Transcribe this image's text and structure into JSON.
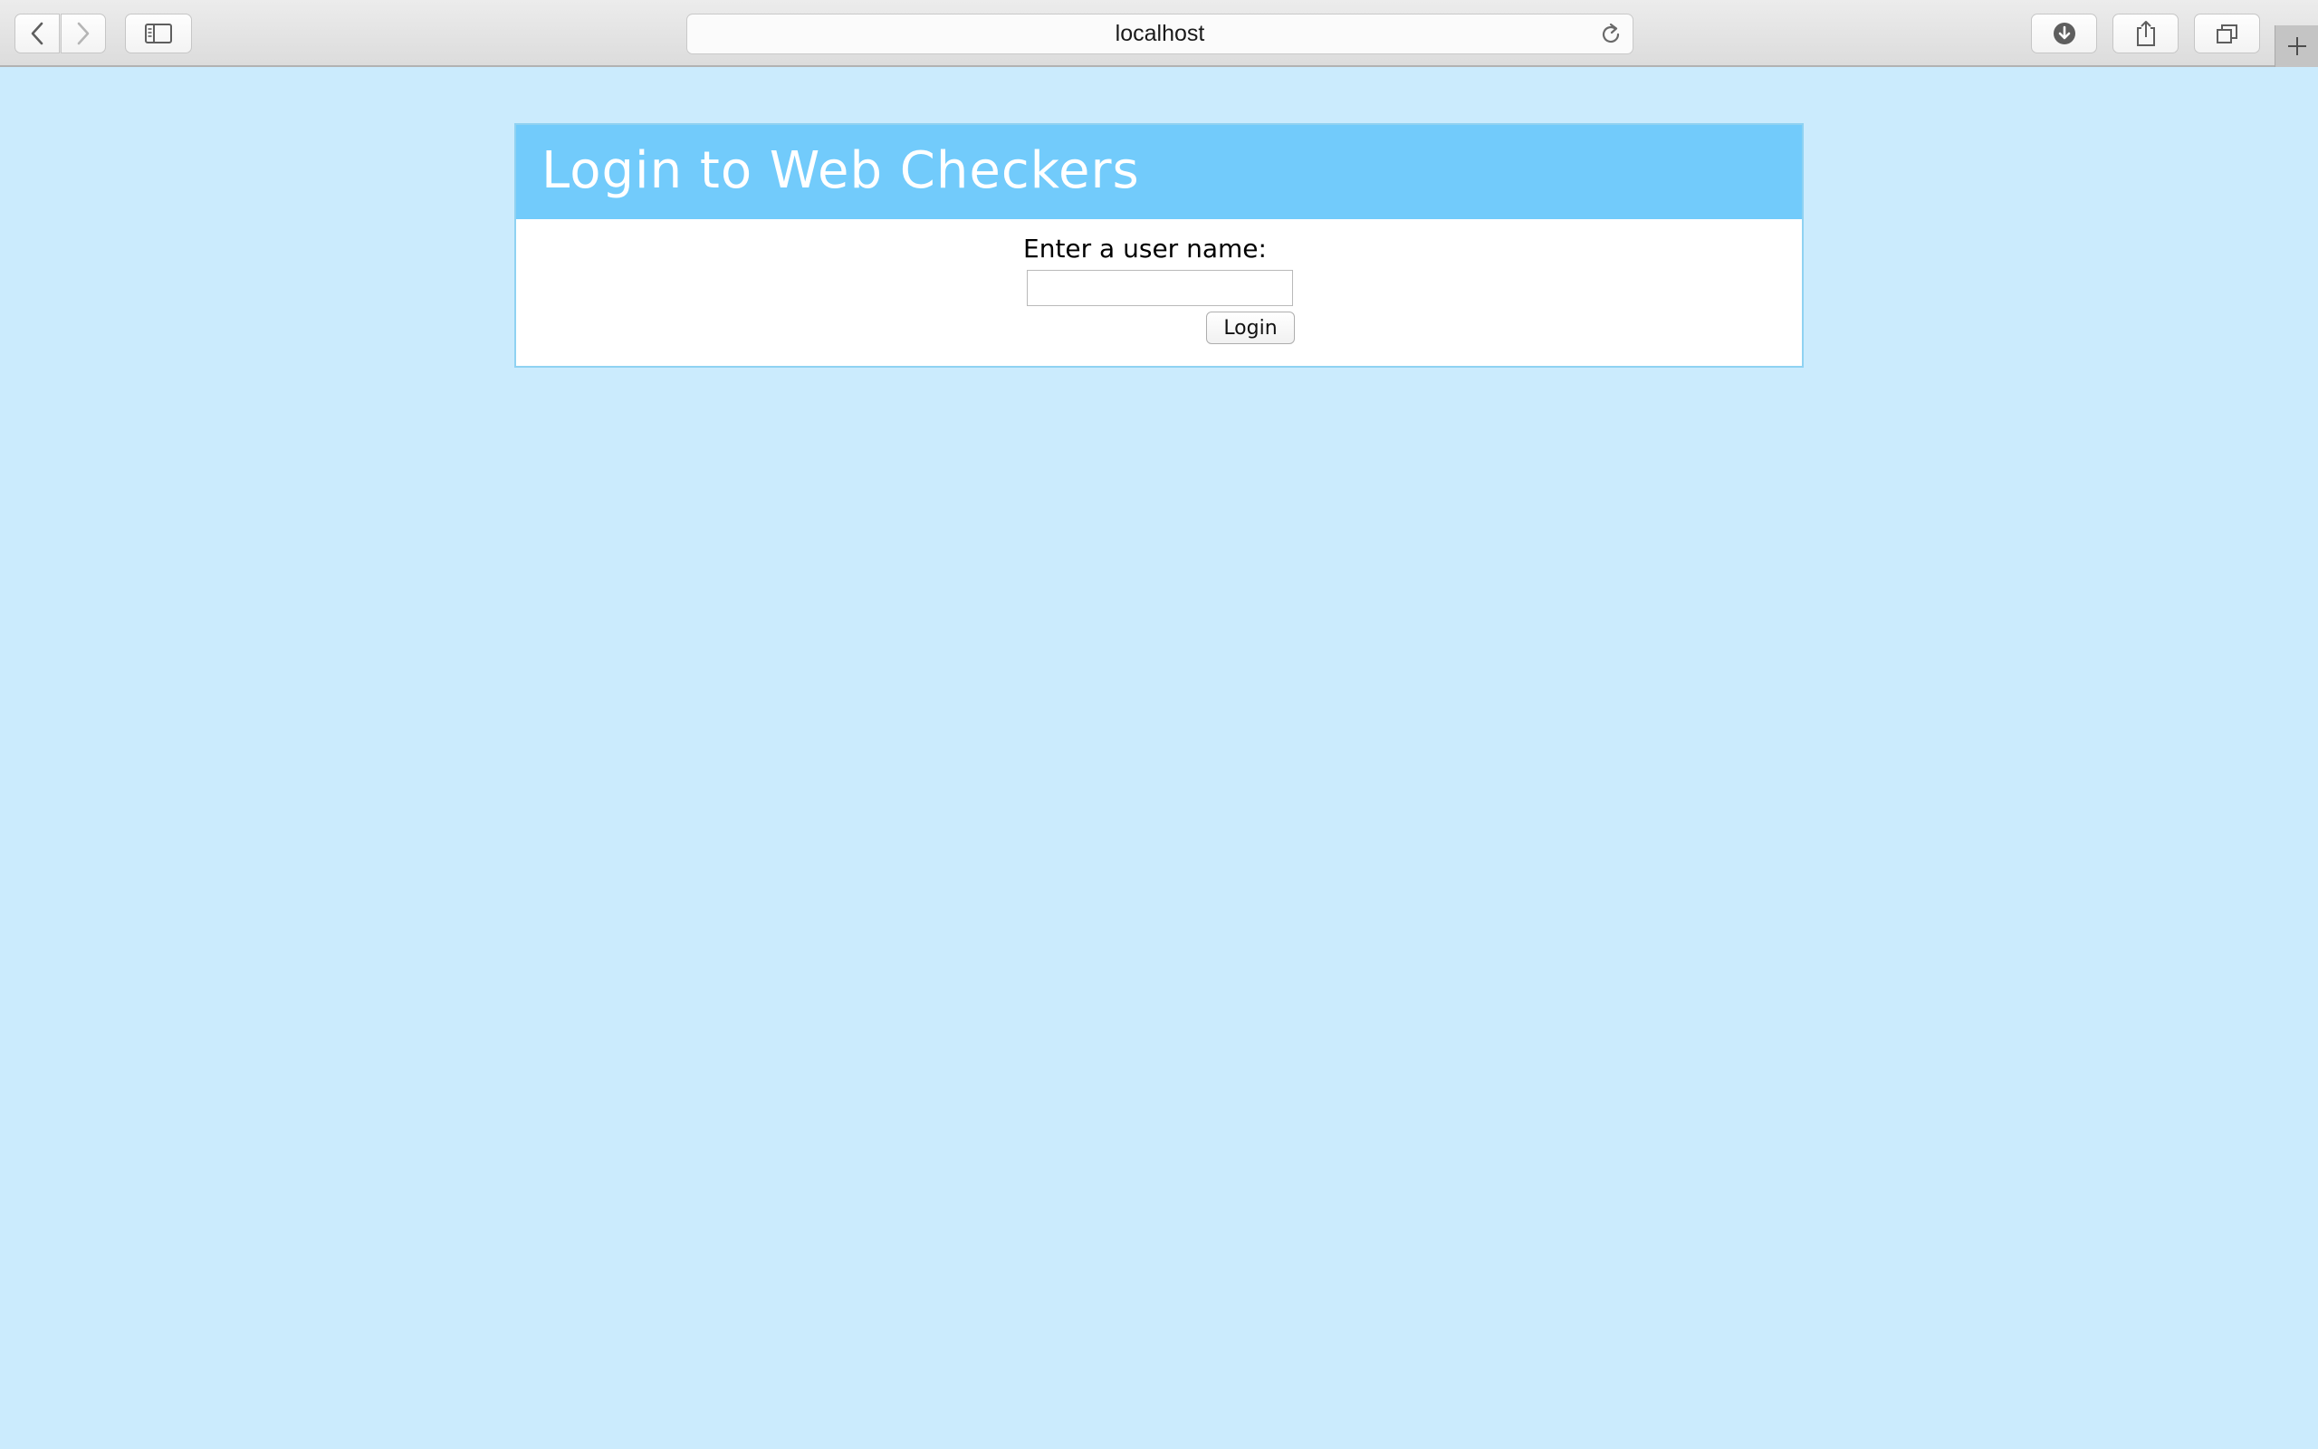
{
  "browser": {
    "address": "localhost",
    "icons": {
      "back": "chevron-left-icon",
      "forward": "chevron-right-icon",
      "sidebar": "sidebar-icon",
      "reload": "reload-icon",
      "download": "download-icon",
      "share": "share-icon",
      "tabs": "tabs-overview-icon",
      "new_tab": "plus-icon"
    }
  },
  "login": {
    "title": "Login to Web Checkers",
    "username_label": "Enter a user name:",
    "username_value": "",
    "button_label": "Login"
  },
  "colors": {
    "page_background": "#cbebfd",
    "header_background": "#72cbfb",
    "panel_border": "#8fd2f2"
  }
}
